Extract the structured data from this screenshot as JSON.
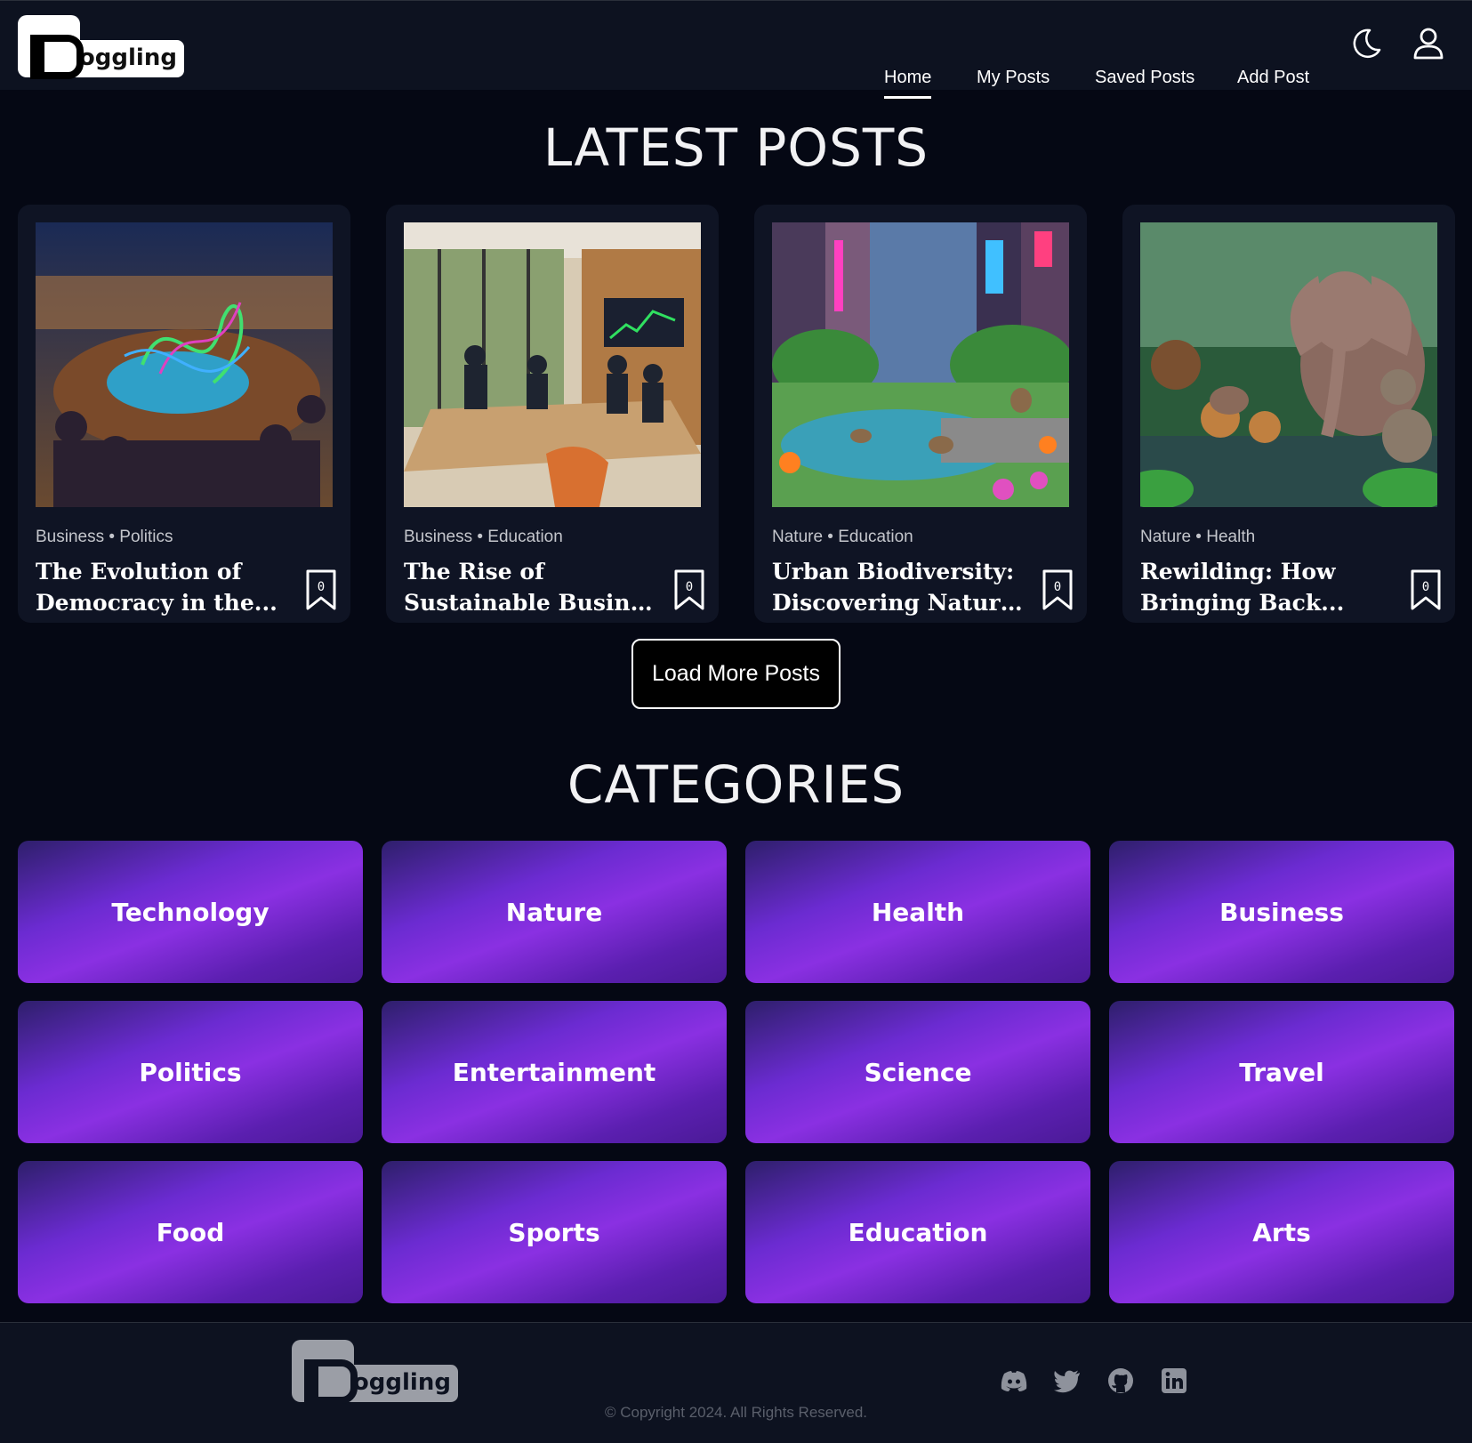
{
  "brand": {
    "name": "loggling",
    "accent": "#8a30e2"
  },
  "nav": {
    "items": [
      {
        "label": "Home",
        "active": true
      },
      {
        "label": "My Posts"
      },
      {
        "label": "Saved Posts"
      },
      {
        "label": "Add Post"
      }
    ],
    "theme_icon": "moon-icon",
    "profile_icon": "user-icon"
  },
  "latest": {
    "title": "LATEST POSTS",
    "posts": [
      {
        "tags": "Business • Politics",
        "title_line1": "The Evolution of",
        "title_line2": "Democracy in the...",
        "bookmark_count": "0"
      },
      {
        "tags": "Business • Education",
        "title_line1": "The Rise of",
        "title_line2": "Sustainable Busines...",
        "bookmark_count": "0"
      },
      {
        "tags": "Nature • Education",
        "title_line1": "Urban Biodiversity:",
        "title_line2": "Discovering Nature i...",
        "bookmark_count": "0"
      },
      {
        "tags": "Nature • Health",
        "title_line1": "Rewilding: How",
        "title_line2": "Bringing Back...",
        "bookmark_count": "0"
      }
    ],
    "load_more_label": "Load More Posts"
  },
  "categories": {
    "title": "CATEGORIES",
    "items": [
      "Technology",
      "Nature",
      "Health",
      "Business",
      "Politics",
      "Entertainment",
      "Science",
      "Travel",
      "Food",
      "Sports",
      "Education",
      "Arts"
    ]
  },
  "footer": {
    "social_icons": [
      "discord-icon",
      "twitter-icon",
      "github-icon",
      "linkedin-icon"
    ],
    "copyright": "© Copyright 2024. All Rights Reserved."
  }
}
